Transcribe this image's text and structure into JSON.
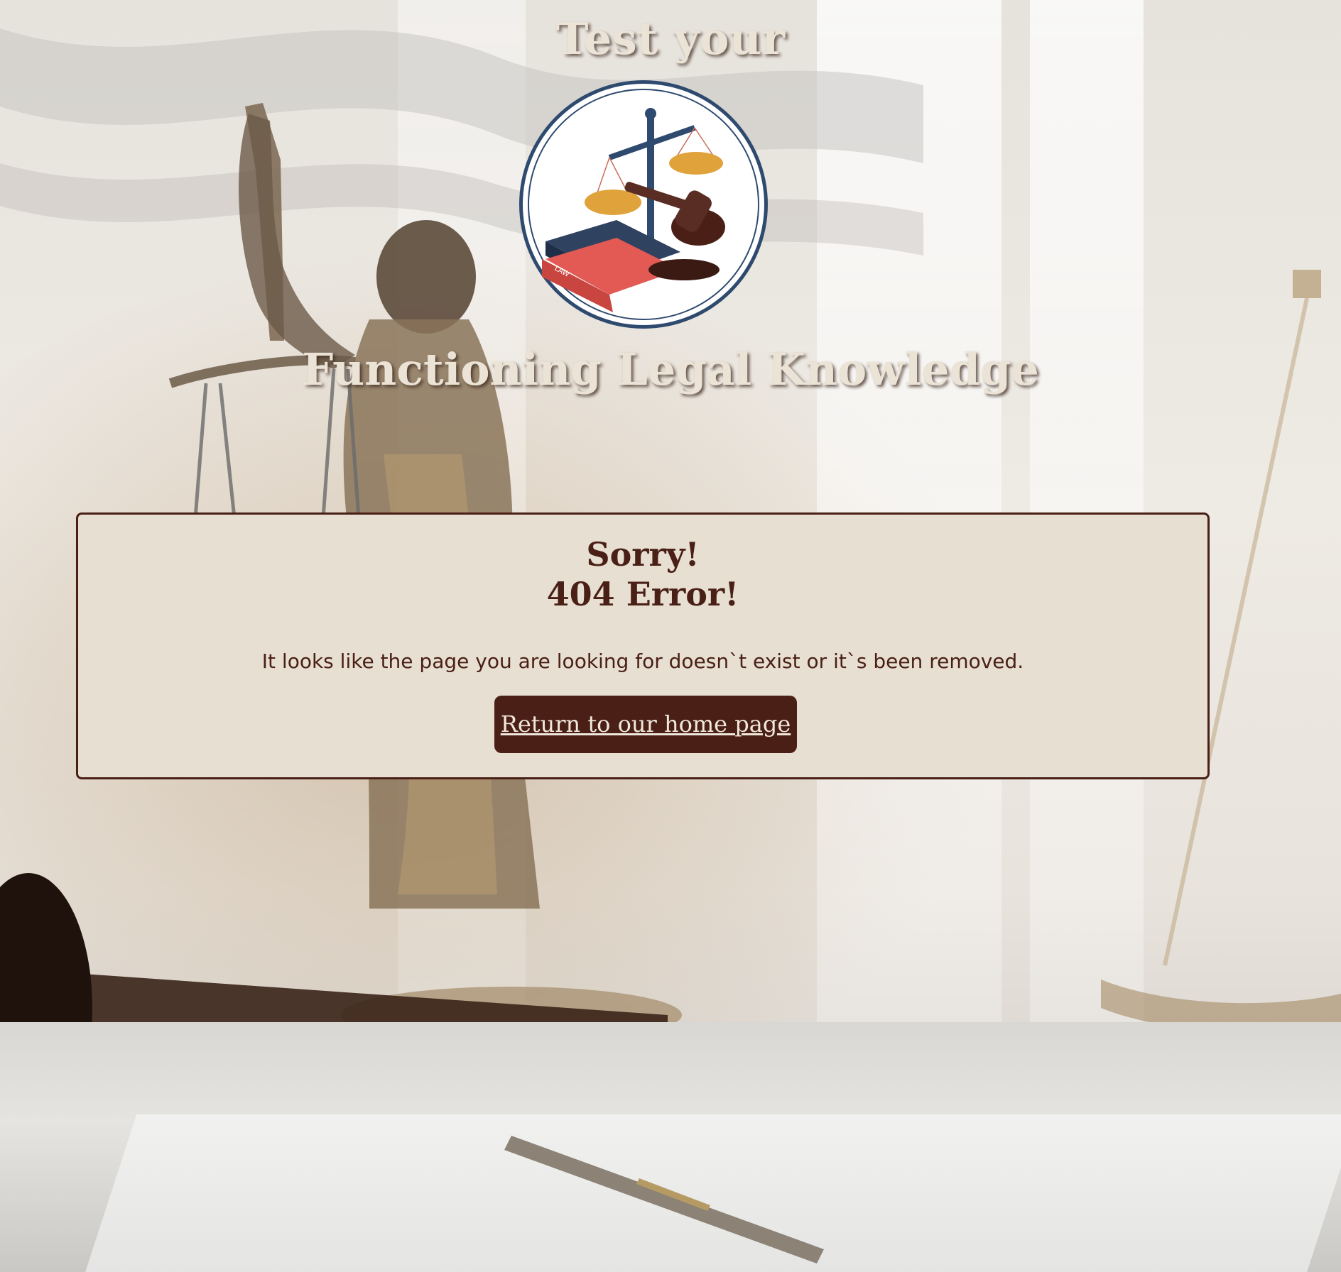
{
  "header": {
    "title_top": "Test your",
    "title_bottom": "Functioning Legal Knowledge",
    "logo_icon": "scales-of-justice-logo-icon",
    "logo_book_text": "LAW"
  },
  "error": {
    "line1": "Sorry!",
    "line2": "404 Error!",
    "message": "It looks like the page you are looking for doesn`t exist or it`s been removed.",
    "home_link": "Return to our home page"
  },
  "colors": {
    "accent": "#4a1f16",
    "card_bg": "#e7dfd2",
    "title_text": "#ebe3d6"
  }
}
